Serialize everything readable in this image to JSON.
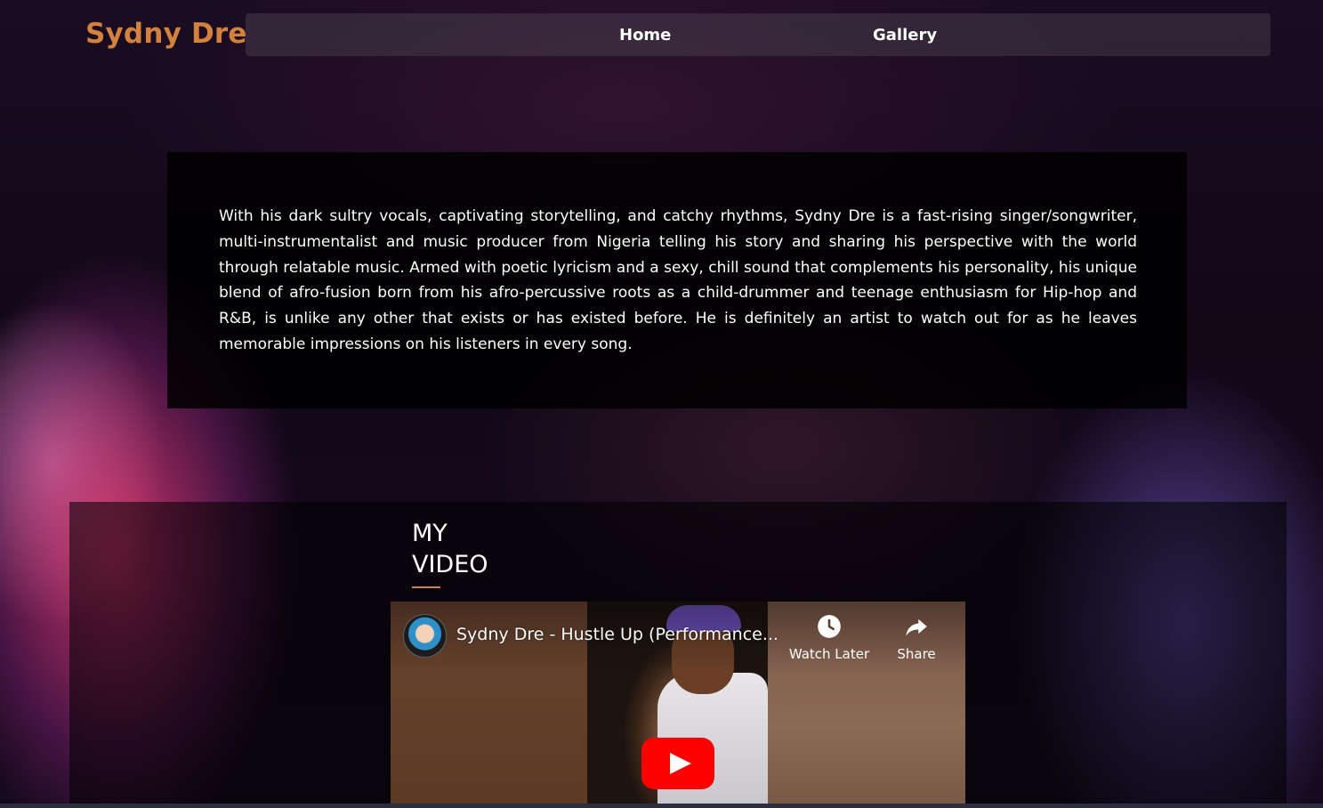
{
  "brand": {
    "name": "Sydny Dre"
  },
  "nav": {
    "items": [
      {
        "label": "Home"
      },
      {
        "label": "Gallery"
      }
    ]
  },
  "bio": {
    "text": "With his dark sultry vocals, captivating storytelling, and catchy rhythms, Sydny Dre is a fast-rising singer/songwriter, multi-instrumentalist and music producer from Nigeria telling his story and sharing his perspective with the world through relatable music. Armed with poetic lyricism and a sexy, chill sound that complements his personality, his unique blend of afro-fusion born from his afro-percussive roots as a child-drummer and teenage enthusiasm for Hip-hop and R&B, is unlike any other that exists or has existed before. He is definitely an artist to watch out for as he leaves memorable impressions on his listeners in every song."
  },
  "video_section": {
    "heading_line1": "MY",
    "heading_line2": "VIDEO",
    "video": {
      "title": "Sydny Dre - Hustle Up (Performance...",
      "watch_later_label": "Watch Later",
      "share_label": "Share",
      "icons": {
        "avatar": "channel-avatar",
        "watch_later": "clock-icon",
        "share": "share-arrow-icon",
        "play": "youtube-play-icon"
      }
    }
  },
  "colors": {
    "brand": "#d2823c",
    "accent_underline": "#d2823c",
    "youtube_red": "#ff0000",
    "text": "#ffffff"
  }
}
